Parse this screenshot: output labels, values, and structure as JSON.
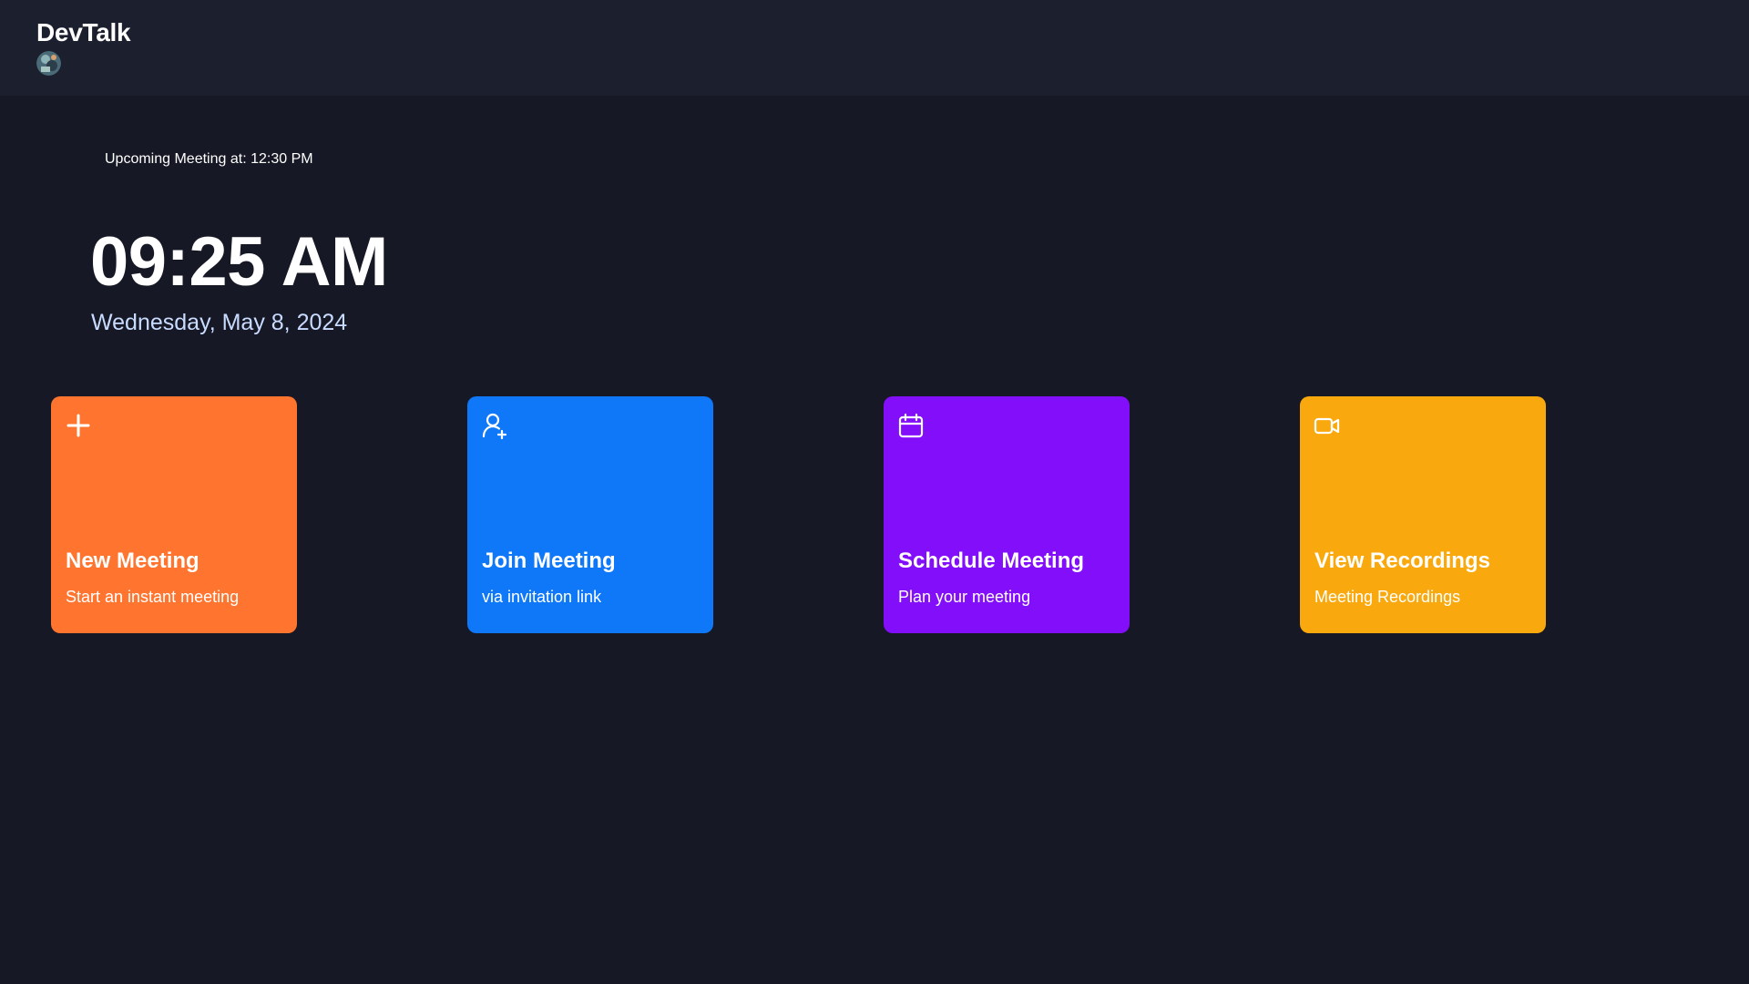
{
  "header": {
    "brand": "DevTalk"
  },
  "home": {
    "upcoming": "Upcoming Meeting at: 12:30 PM",
    "time": "09:25 AM",
    "date": "Wednesday, May 8, 2024"
  },
  "cards": [
    {
      "title": "New Meeting",
      "subtitle": "Start an instant meeting",
      "icon": "plus-icon",
      "color": "#ff742e"
    },
    {
      "title": "Join Meeting",
      "subtitle": "via invitation link",
      "icon": "user-plus-icon",
      "color": "#0e78f9"
    },
    {
      "title": "Schedule Meeting",
      "subtitle": "Plan your meeting",
      "icon": "calendar-icon",
      "color": "#830ef9"
    },
    {
      "title": "View Recordings",
      "subtitle": "Meeting Recordings",
      "icon": "video-icon",
      "color": "#f9a90e"
    }
  ],
  "colors": {
    "background": "#161925",
    "topbar": "#1c1f2e",
    "date_text": "#c9dcff"
  }
}
